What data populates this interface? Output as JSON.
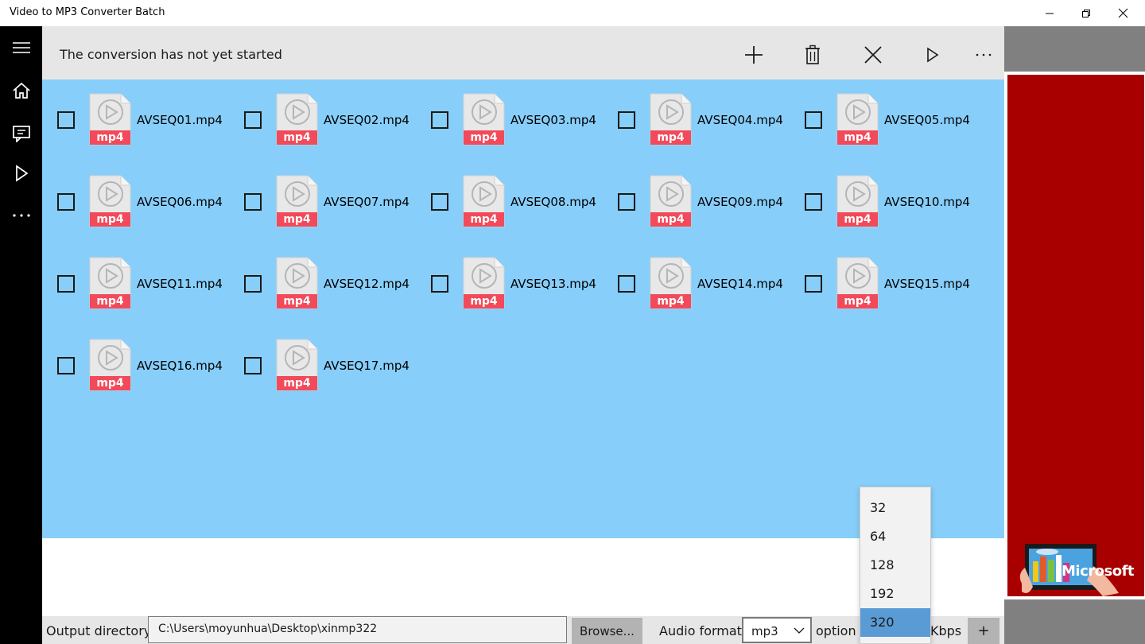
{
  "window": {
    "title": "Video to MP3 Converter Batch"
  },
  "command_bar": {
    "status": "The conversion has not yet started"
  },
  "files": [
    {
      "name": "AVSEQ01.mp4",
      "badge": "mp4"
    },
    {
      "name": "AVSEQ02.mp4",
      "badge": "mp4"
    },
    {
      "name": "AVSEQ03.mp4",
      "badge": "mp4"
    },
    {
      "name": "AVSEQ04.mp4",
      "badge": "mp4"
    },
    {
      "name": "AVSEQ05.mp4",
      "badge": "mp4"
    },
    {
      "name": "AVSEQ06.mp4",
      "badge": "mp4"
    },
    {
      "name": "AVSEQ07.mp4",
      "badge": "mp4"
    },
    {
      "name": "AVSEQ08.mp4",
      "badge": "mp4"
    },
    {
      "name": "AVSEQ09.mp4",
      "badge": "mp4"
    },
    {
      "name": "AVSEQ10.mp4",
      "badge": "mp4"
    },
    {
      "name": "AVSEQ11.mp4",
      "badge": "mp4"
    },
    {
      "name": "AVSEQ12.mp4",
      "badge": "mp4"
    },
    {
      "name": "AVSEQ13.mp4",
      "badge": "mp4"
    },
    {
      "name": "AVSEQ14.mp4",
      "badge": "mp4"
    },
    {
      "name": "AVSEQ15.mp4",
      "badge": "mp4"
    },
    {
      "name": "AVSEQ16.mp4",
      "badge": "mp4"
    },
    {
      "name": "AVSEQ17.mp4",
      "badge": "mp4"
    }
  ],
  "bottom_bar": {
    "output_label": "Output directory",
    "output_path": "C:\\Users\\moyunhua\\Desktop\\xinmp322",
    "browse_label": "Browse...",
    "audio_format_label": "Audio format",
    "audio_format_value": "mp3",
    "option_label": "option",
    "kbps_label": "Kbps",
    "add_label": "+"
  },
  "bitrate_options": [
    "32",
    "64",
    "128",
    "192",
    "320"
  ],
  "bitrate_selected": "320",
  "ad": {
    "logo_text": "Microsoft"
  },
  "colors": {
    "file_area": "#87cefa",
    "ad_background": "#a80000",
    "badge": "#f24a5a",
    "selected_option": "#5b9bd5"
  }
}
